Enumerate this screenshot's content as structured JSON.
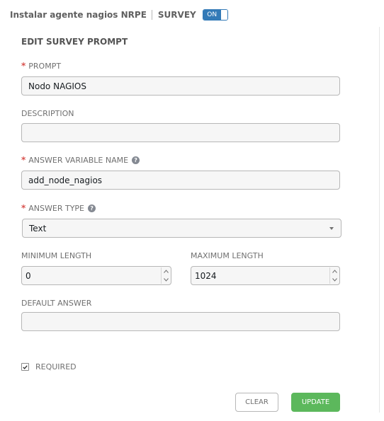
{
  "header": {
    "job_name": "Instalar agente nagios NRPE",
    "survey_label": "SURVEY",
    "toggle_label": "ON"
  },
  "form": {
    "title": "EDIT SURVEY PROMPT",
    "required_marker": "*",
    "help_glyph": "?",
    "prompt": {
      "label": "PROMPT",
      "value": "Nodo NAGIOS"
    },
    "description": {
      "label": "DESCRIPTION",
      "value": ""
    },
    "answer_variable_name": {
      "label": "ANSWER VARIABLE NAME",
      "value": "add_node_nagios"
    },
    "answer_type": {
      "label": "ANSWER TYPE",
      "value": "Text"
    },
    "minimum_length": {
      "label": "MINIMUM LENGTH",
      "value": "0"
    },
    "maximum_length": {
      "label": "MAXIMUM LENGTH",
      "value": "1024"
    },
    "default_answer": {
      "label": "DEFAULT ANSWER",
      "value": ""
    },
    "required": {
      "label": "REQUIRED",
      "checked": true
    }
  },
  "buttons": {
    "clear_label": "CLEAR",
    "update_label": "UPDATE"
  },
  "colors": {
    "toggle_on": "#337ab7",
    "required_asterisk": "#d9534f",
    "update_button": "#5cb85c"
  },
  "icons": {
    "help": "question-circle-icon",
    "dropdown": "caret-down-icon",
    "spinner_up": "chevron-up-icon",
    "spinner_down": "chevron-down-icon",
    "checkbox": "check-icon"
  }
}
